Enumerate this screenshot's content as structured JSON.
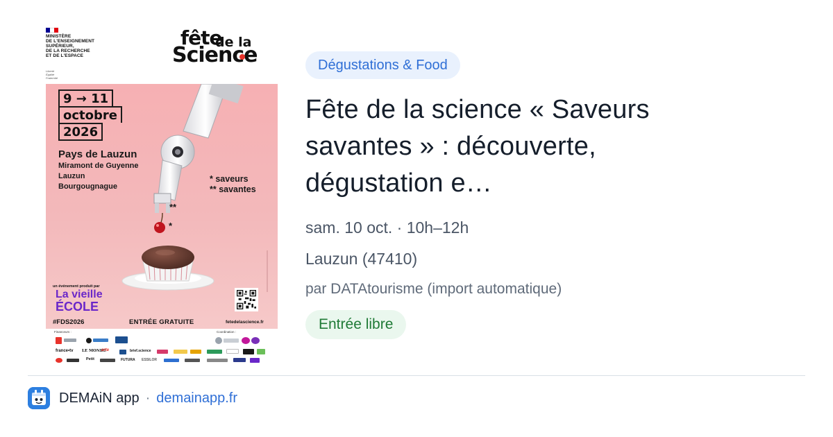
{
  "poster": {
    "ministry_text": "MINISTÈRE\nDE L'ENSEIGNEMENT\nSUPÉRIEUR,\nDE LA RECHERCHE\nET DE L'ESPACE",
    "motto": "Liberté\nÉgalité\nFraternité",
    "logo_line1": "fête",
    "logo_line1b": "de la",
    "logo_line2": "Science",
    "date_line1": "9 → 11",
    "date_line2": "octobre",
    "date_line3": "2026",
    "place_main": "Pays de Lauzun",
    "place_towns": [
      "Miramont de Guyenne",
      "Lauzun",
      "Bourgougnague"
    ],
    "saveurs_note": "* saveurs\n** savantes",
    "star_single": "*",
    "star_double": "**",
    "produced_by": "un événement produit par",
    "organizer_line1": "La vieille",
    "organizer_line2": "ÉCOLE",
    "hashtag": "#FDS2026",
    "entry_text": "ENTRÉE GRATUITE",
    "site": "fetedelascience.fr",
    "partners_label": "Financeurs :",
    "coordination_label": "Coordination :",
    "media_logos": [
      "france•tv",
      "LE MONDE",
      "arte",
      "brief.science",
      "Petit",
      "FUTURA",
      "ESSILOR"
    ],
    "colors": {
      "flag_blue": "#000091",
      "flag_red": "#e1000f",
      "poster_bg": "#f6b0b3",
      "organizer": "#6a27c9",
      "logo_dot": "#e8332b"
    }
  },
  "card": {
    "category": "Dégustations & Food",
    "title_lines": [
      "Fête de la science « Saveurs",
      "savantes » : découverte,",
      "dégustation e…"
    ],
    "date_time": "sam. 10 oct. · 10h–12h",
    "location": "Lauzun (47410)",
    "author": "par DATAtourisme (import automatique)",
    "price": "Entrée libre",
    "colors": {
      "category_bg": "#e9f1fd",
      "category_text": "#2f6fd6",
      "price_bg": "#eaf7ee",
      "price_text": "#1f7a36"
    }
  },
  "footer": {
    "app_name": "DEMAiN app",
    "separator": "·",
    "domain": "demainapp.fr",
    "icon": "demain-app-icon",
    "colors": {
      "icon_bg": "#2d7fe0",
      "link": "#2f6fd6"
    }
  }
}
